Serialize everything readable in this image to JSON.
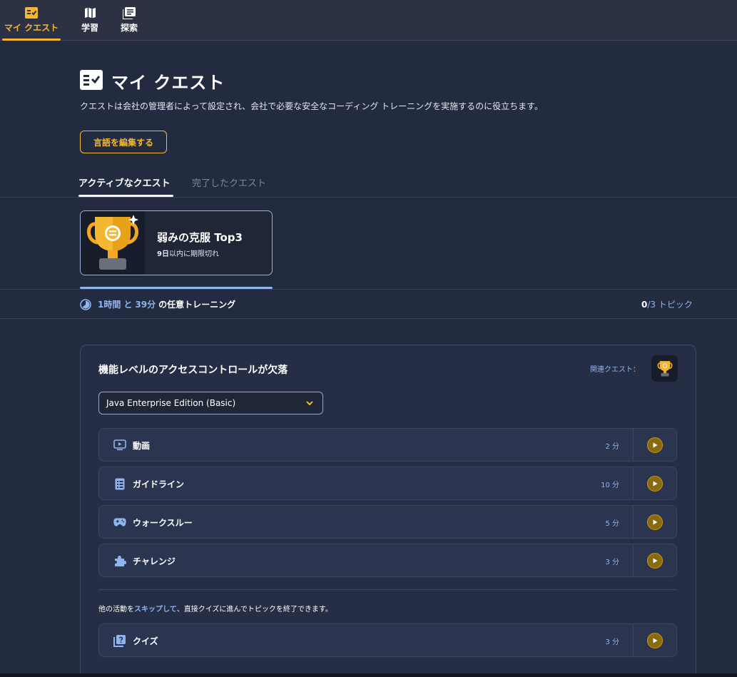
{
  "nav": {
    "items": [
      {
        "label": "マイ クエスト",
        "icon": "quest-checklist-icon",
        "active": true
      },
      {
        "label": "学習",
        "icon": "map-icon",
        "active": false
      },
      {
        "label": "探索",
        "icon": "library-icon",
        "active": false
      }
    ]
  },
  "page": {
    "title": "マイ クエスト",
    "description": "クエストは会社の管理者によって設定され、会社で必要な安全なコーディング トレーニングを実施するのに役立ちます。",
    "edit_language_label": "言語を編集する"
  },
  "tabs": {
    "active_label": "アクティブなクエスト",
    "completed_label": "完了したクエスト"
  },
  "quest": {
    "title": "弱みの克服 Top3",
    "expiry_days": "9日",
    "expiry_suffix": "以内に期限切れ"
  },
  "training": {
    "hours": "1時間",
    "and": "と",
    "minutes": "39分",
    "suffix": "の任意トレーニング",
    "topics_done": "0",
    "topics_total": "/3 トピック"
  },
  "topic": {
    "title": "機能レベルのアクセスコントロールが欠落",
    "related_label": "関連クエスト：",
    "language_selected": "Java Enterprise Edition (Basic)",
    "activities": [
      {
        "label": "動画",
        "time": "2 分",
        "icon": "video-icon"
      },
      {
        "label": "ガイドライン",
        "time": "10 分",
        "icon": "guideline-icon"
      },
      {
        "label": "ウォークスルー",
        "time": "5 分",
        "icon": "gamepad-icon"
      },
      {
        "label": "チャレンジ",
        "time": "3 分",
        "icon": "puzzle-icon"
      }
    ],
    "skip_prefix": "他の活動を",
    "skip_link": "スキップして",
    "skip_suffix": "、直接クイズに進んでトピックを終了できます。",
    "quiz": {
      "label": "クイズ",
      "time": "3 分",
      "icon": "quiz-icon"
    }
  },
  "colors": {
    "accent": "#f5b731",
    "link": "#8fb4f0",
    "background": "#222b40"
  }
}
